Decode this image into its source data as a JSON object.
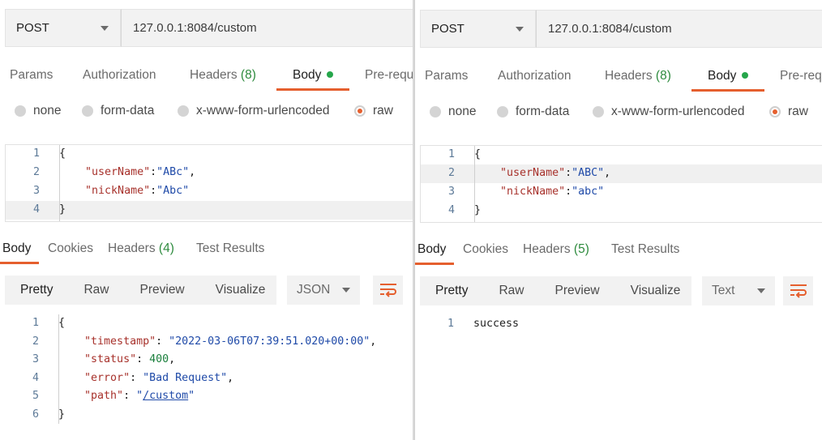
{
  "left": {
    "method": "POST",
    "url": "127.0.0.1:8084/custom",
    "request_tabs": {
      "params": "Params",
      "authorization": "Authorization",
      "headers": "Headers",
      "headers_count": "(8)",
      "body": "Body",
      "prerequest": "Pre-requ"
    },
    "body_modes": {
      "none": "none",
      "form_data": "form-data",
      "urlencoded": "x-www-form-urlencoded",
      "raw": "raw"
    },
    "request_body": {
      "line_numbers": [
        "1",
        "2",
        "3",
        "4"
      ],
      "open_brace": "{",
      "close_brace": "}",
      "userName_key": "\"userName\"",
      "userName_value": "\"ABc\"",
      "nickName_key": "\"nickName\"",
      "nickName_value": "\"Abc\""
    },
    "response_tabs": {
      "body": "Body",
      "cookies": "Cookies",
      "headers": "Headers",
      "headers_count": "(4)",
      "test_results": "Test Results"
    },
    "view_modes": {
      "pretty": "Pretty",
      "raw": "Raw",
      "preview": "Preview",
      "visualize": "Visualize"
    },
    "format": "JSON",
    "response_body": {
      "line_numbers": [
        "1",
        "2",
        "3",
        "4",
        "5",
        "6"
      ],
      "open_brace": "{",
      "close_brace": "}",
      "timestamp_key": "\"timestamp\"",
      "timestamp_value": "\"2022-03-06T07:39:51.020+00:00\"",
      "status_key": "\"status\"",
      "status_value": "400",
      "error_key": "\"error\"",
      "error_value": "\"Bad Request\"",
      "path_key": "\"path\"",
      "path_value_pre": "\"",
      "path_value_link": "/custom",
      "path_value_post": "\""
    }
  },
  "right": {
    "method": "POST",
    "url": "127.0.0.1:8084/custom",
    "request_tabs": {
      "params": "Params",
      "authorization": "Authorization",
      "headers": "Headers",
      "headers_count": "(8)",
      "body": "Body",
      "prerequest": "Pre-req"
    },
    "body_modes": {
      "none": "none",
      "form_data": "form-data",
      "urlencoded": "x-www-form-urlencoded",
      "raw": "raw"
    },
    "request_body": {
      "line_numbers": [
        "1",
        "2",
        "3",
        "4"
      ],
      "open_brace": "{",
      "close_brace": "}",
      "userName_key": "\"userName\"",
      "userName_value": "\"ABC\"",
      "nickName_key": "\"nickName\"",
      "nickName_value": "\"abc\""
    },
    "response_tabs": {
      "body": "Body",
      "cookies": "Cookies",
      "headers": "Headers",
      "headers_count": "(5)",
      "test_results": "Test Results"
    },
    "view_modes": {
      "pretty": "Pretty",
      "raw": "Raw",
      "preview": "Preview",
      "visualize": "Visualize"
    },
    "format": "Text",
    "response_body": {
      "line_numbers": [
        "1"
      ],
      "text": "success"
    }
  },
  "colors": {
    "accent": "#e55f2e",
    "active_dot": "#26a64b",
    "count_green": "#2e8b3e",
    "json_key": "#a7312b",
    "json_string": "#1f4aa8",
    "json_number": "#1a7f3c"
  },
  "icons": {
    "method_dropdown": "chevron-down-icon",
    "wrap": "wrap-lines-icon"
  }
}
